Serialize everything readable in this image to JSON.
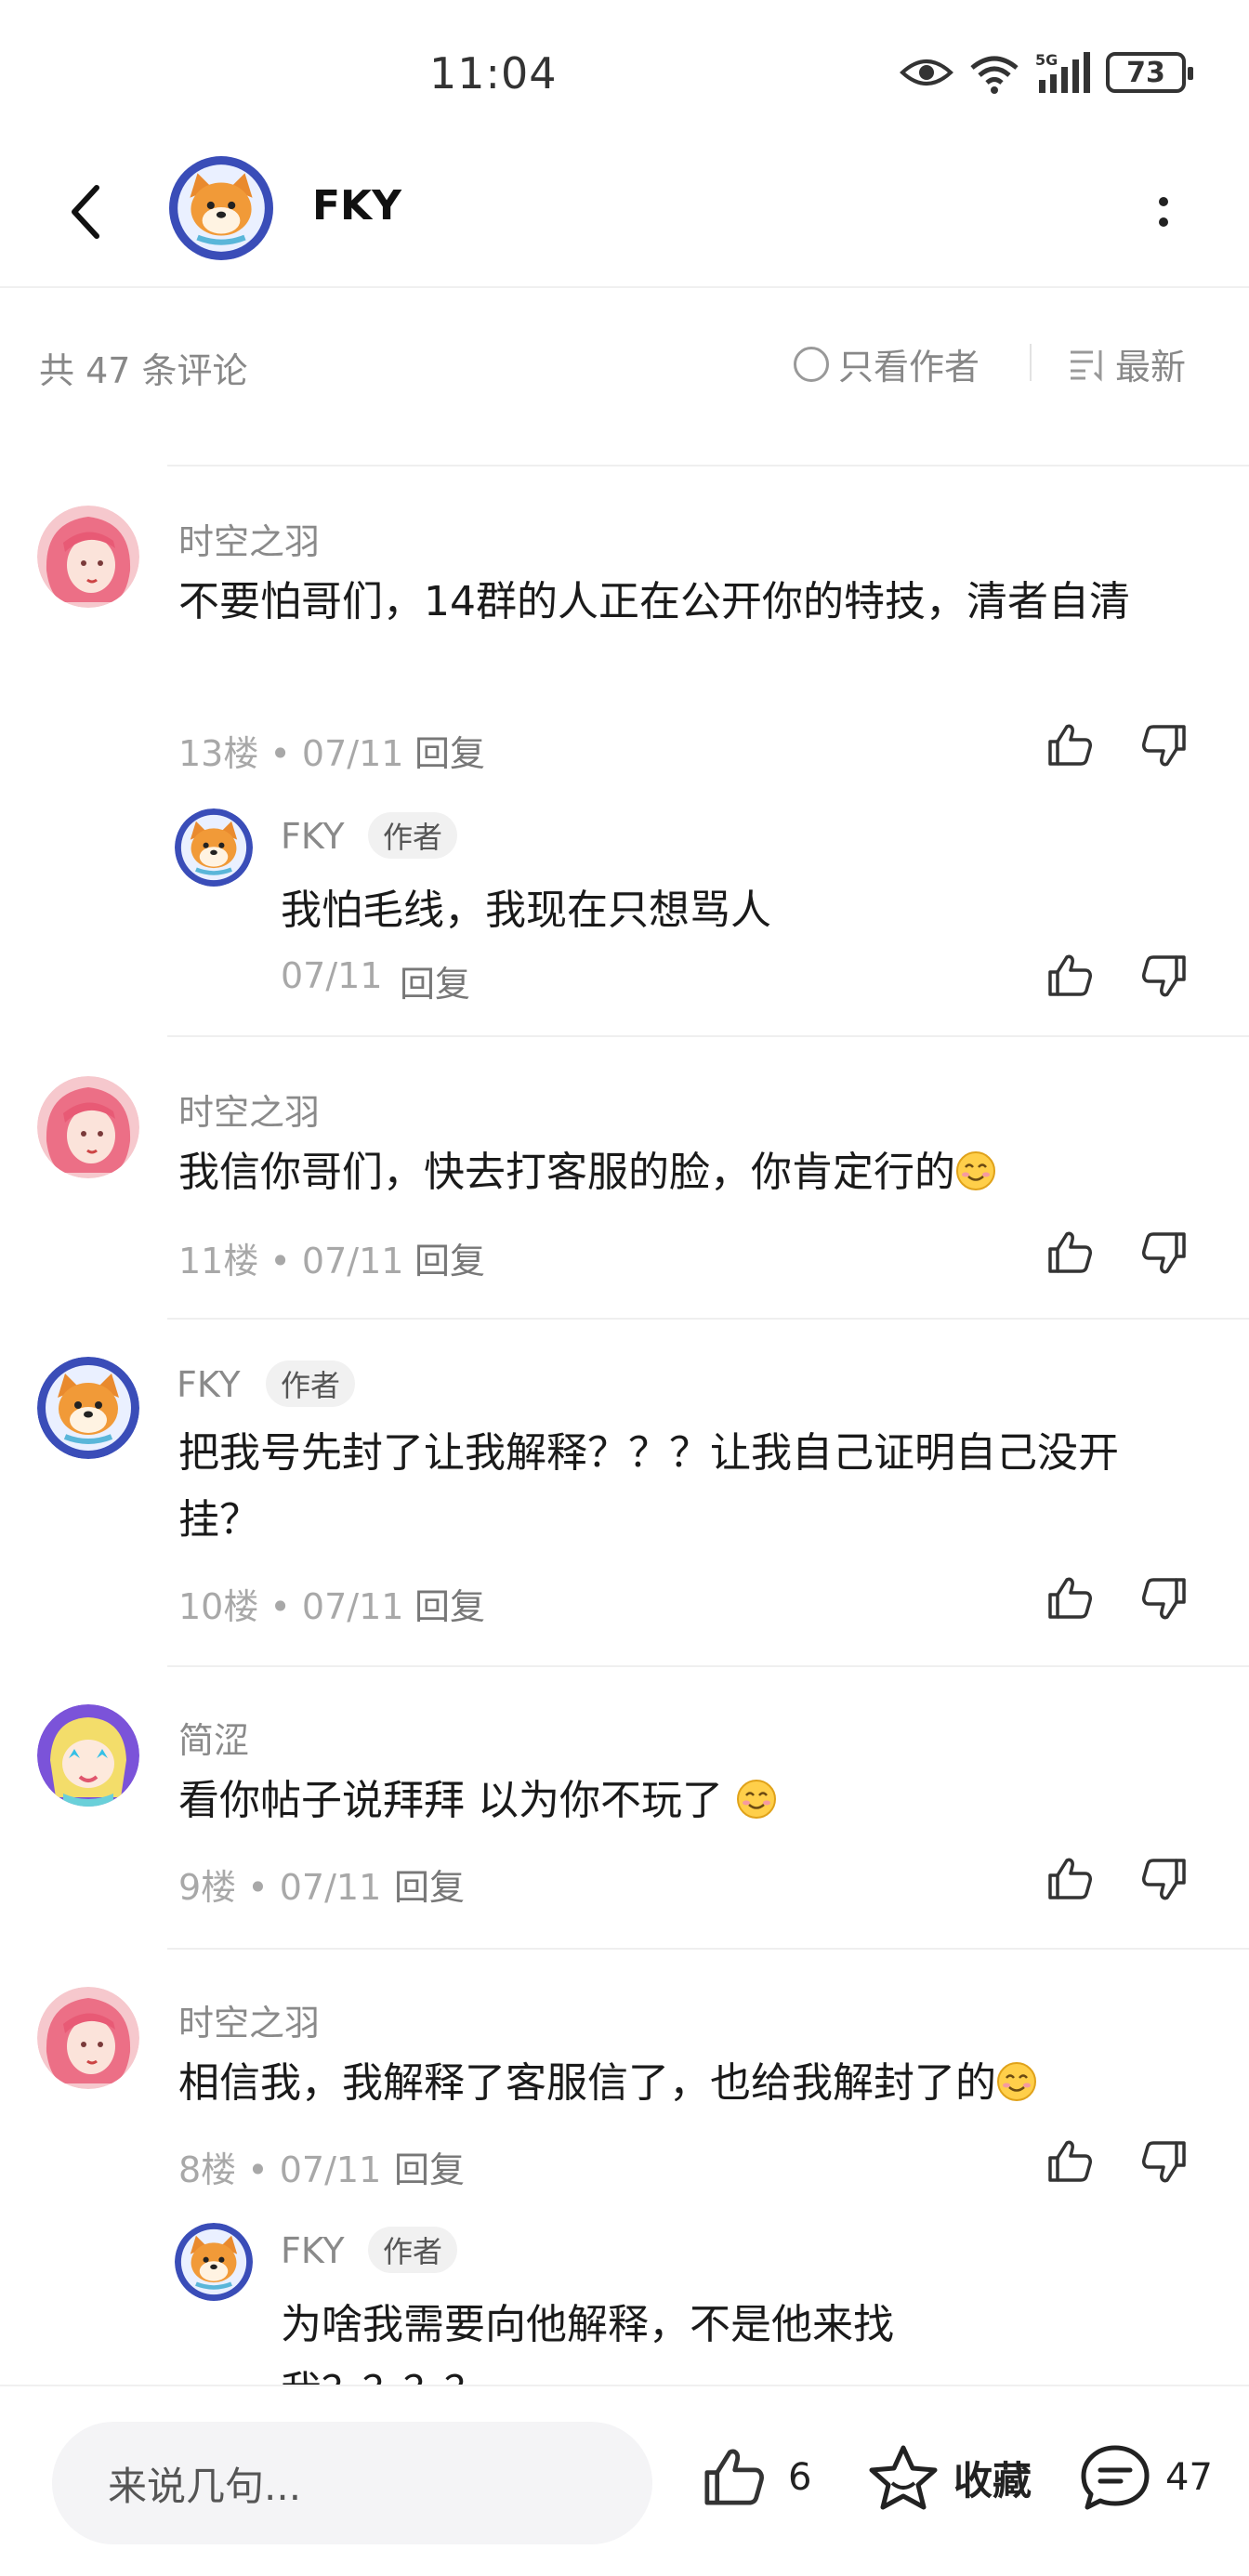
{
  "status": {
    "time": "11:04",
    "battery": "73",
    "network": "5G"
  },
  "header": {
    "title": "FKY"
  },
  "filter": {
    "count": "共 47 条评论",
    "only_author": "只看作者",
    "sort": "最新"
  },
  "author_badge": "作者",
  "reply_label": "回复",
  "comments": [
    {
      "user": "时空之羽",
      "text": "不要怕哥们，14群的人正在公开你的特技，清者自清",
      "meta": "13楼 • 07/11"
    },
    {
      "user": "FKY",
      "text": "我怕毛线，我现在只想骂人",
      "meta": "07/11"
    },
    {
      "user": "时空之羽",
      "text": "我信你哥们，快去打客服的脸，你肯定行的",
      "meta": "11楼 • 07/11"
    },
    {
      "user": "FKY",
      "text": "把我号先封了让我解释？？？让我自己证明自己没开挂？",
      "meta": "10楼 • 07/11"
    },
    {
      "user": "简涩",
      "text": "看你帖子说拜拜 以为你不玩了 ",
      "meta": "9楼 • 07/11"
    },
    {
      "user": "时空之羽",
      "text": "相信我，我解释了客服信了，也给我解封了的",
      "meta": "8楼 • 07/11"
    },
    {
      "user": "FKY",
      "text": "为啥我需要向他解释，不是他来找我？？？？",
      "meta": ""
    }
  ],
  "bottom": {
    "placeholder": "来说几句...",
    "likes": "6",
    "favorite": "收藏",
    "comments": "47"
  },
  "colors": {
    "text": "#1a1a1a",
    "muted": "#8a8a8a",
    "input_bg": "#f4f4f6",
    "divider": "#efefef"
  }
}
